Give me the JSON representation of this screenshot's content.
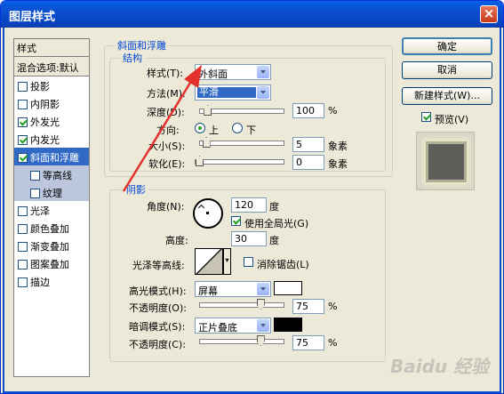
{
  "window": {
    "title": "图层样式",
    "close": "×"
  },
  "left_panel": {
    "header": "样式",
    "blend": "混合选项:默认",
    "items": [
      {
        "label": "投影",
        "checked": false
      },
      {
        "label": "内阴影",
        "checked": false
      },
      {
        "label": "外发光",
        "checked": true
      },
      {
        "label": "内发光",
        "checked": true
      },
      {
        "label": "斜面和浮雕",
        "checked": true
      },
      {
        "label": "等高线",
        "checked": false
      },
      {
        "label": "纹理",
        "checked": false
      },
      {
        "label": "光泽",
        "checked": false
      },
      {
        "label": "颜色叠加",
        "checked": false
      },
      {
        "label": "渐变叠加",
        "checked": false
      },
      {
        "label": "图案叠加",
        "checked": false
      },
      {
        "label": "描边",
        "checked": false
      }
    ]
  },
  "bevel": {
    "group": "斜面和浮雕",
    "structure": "结构",
    "style_label": "样式(T):",
    "style_value": "外斜面",
    "method_label": "方法(M):",
    "method_value": "平滑",
    "depth_label": "深度(D):",
    "depth_value": "100",
    "depth_unit": "%",
    "depth_level": 0.05,
    "direction_label": "方向:",
    "dir_up": "上",
    "dir_down": "下",
    "size_label": "大小(S):",
    "size_value": "5",
    "size_unit": "象素",
    "size_level": 0.03,
    "soften_label": "软化(E):",
    "soften_value": "0",
    "soften_unit": "象素",
    "soften_level": 0
  },
  "shading": {
    "group": "阴影",
    "angle_label": "角度(N):",
    "angle_value": "120",
    "angle_unit": "度",
    "global_light": "使用全局光(G)",
    "altitude_label": "高度:",
    "altitude_value": "30",
    "altitude_unit": "度",
    "gloss_label": "光泽等高线:",
    "antialias": "消除锯齿(L)",
    "highlight_label": "高光模式(H):",
    "highlight_value": "屏幕",
    "highlight_color": "#ffffff",
    "hl_opacity_label": "不透明度(O):",
    "hl_opacity_value": "75",
    "hl_opacity_level": 0.75,
    "pct": "%",
    "shadow_label": "暗调模式(S):",
    "shadow_value": "正片叠底",
    "shadow_color": "#000000",
    "sh_opacity_label": "不透明度(C):",
    "sh_opacity_value": "75",
    "sh_opacity_level": 0.75
  },
  "buttons": {
    "ok": "确定",
    "cancel": "取消",
    "new_style": "新建样式(W)...",
    "preview": "预览(V)"
  },
  "watermark": "Baidu 经验"
}
